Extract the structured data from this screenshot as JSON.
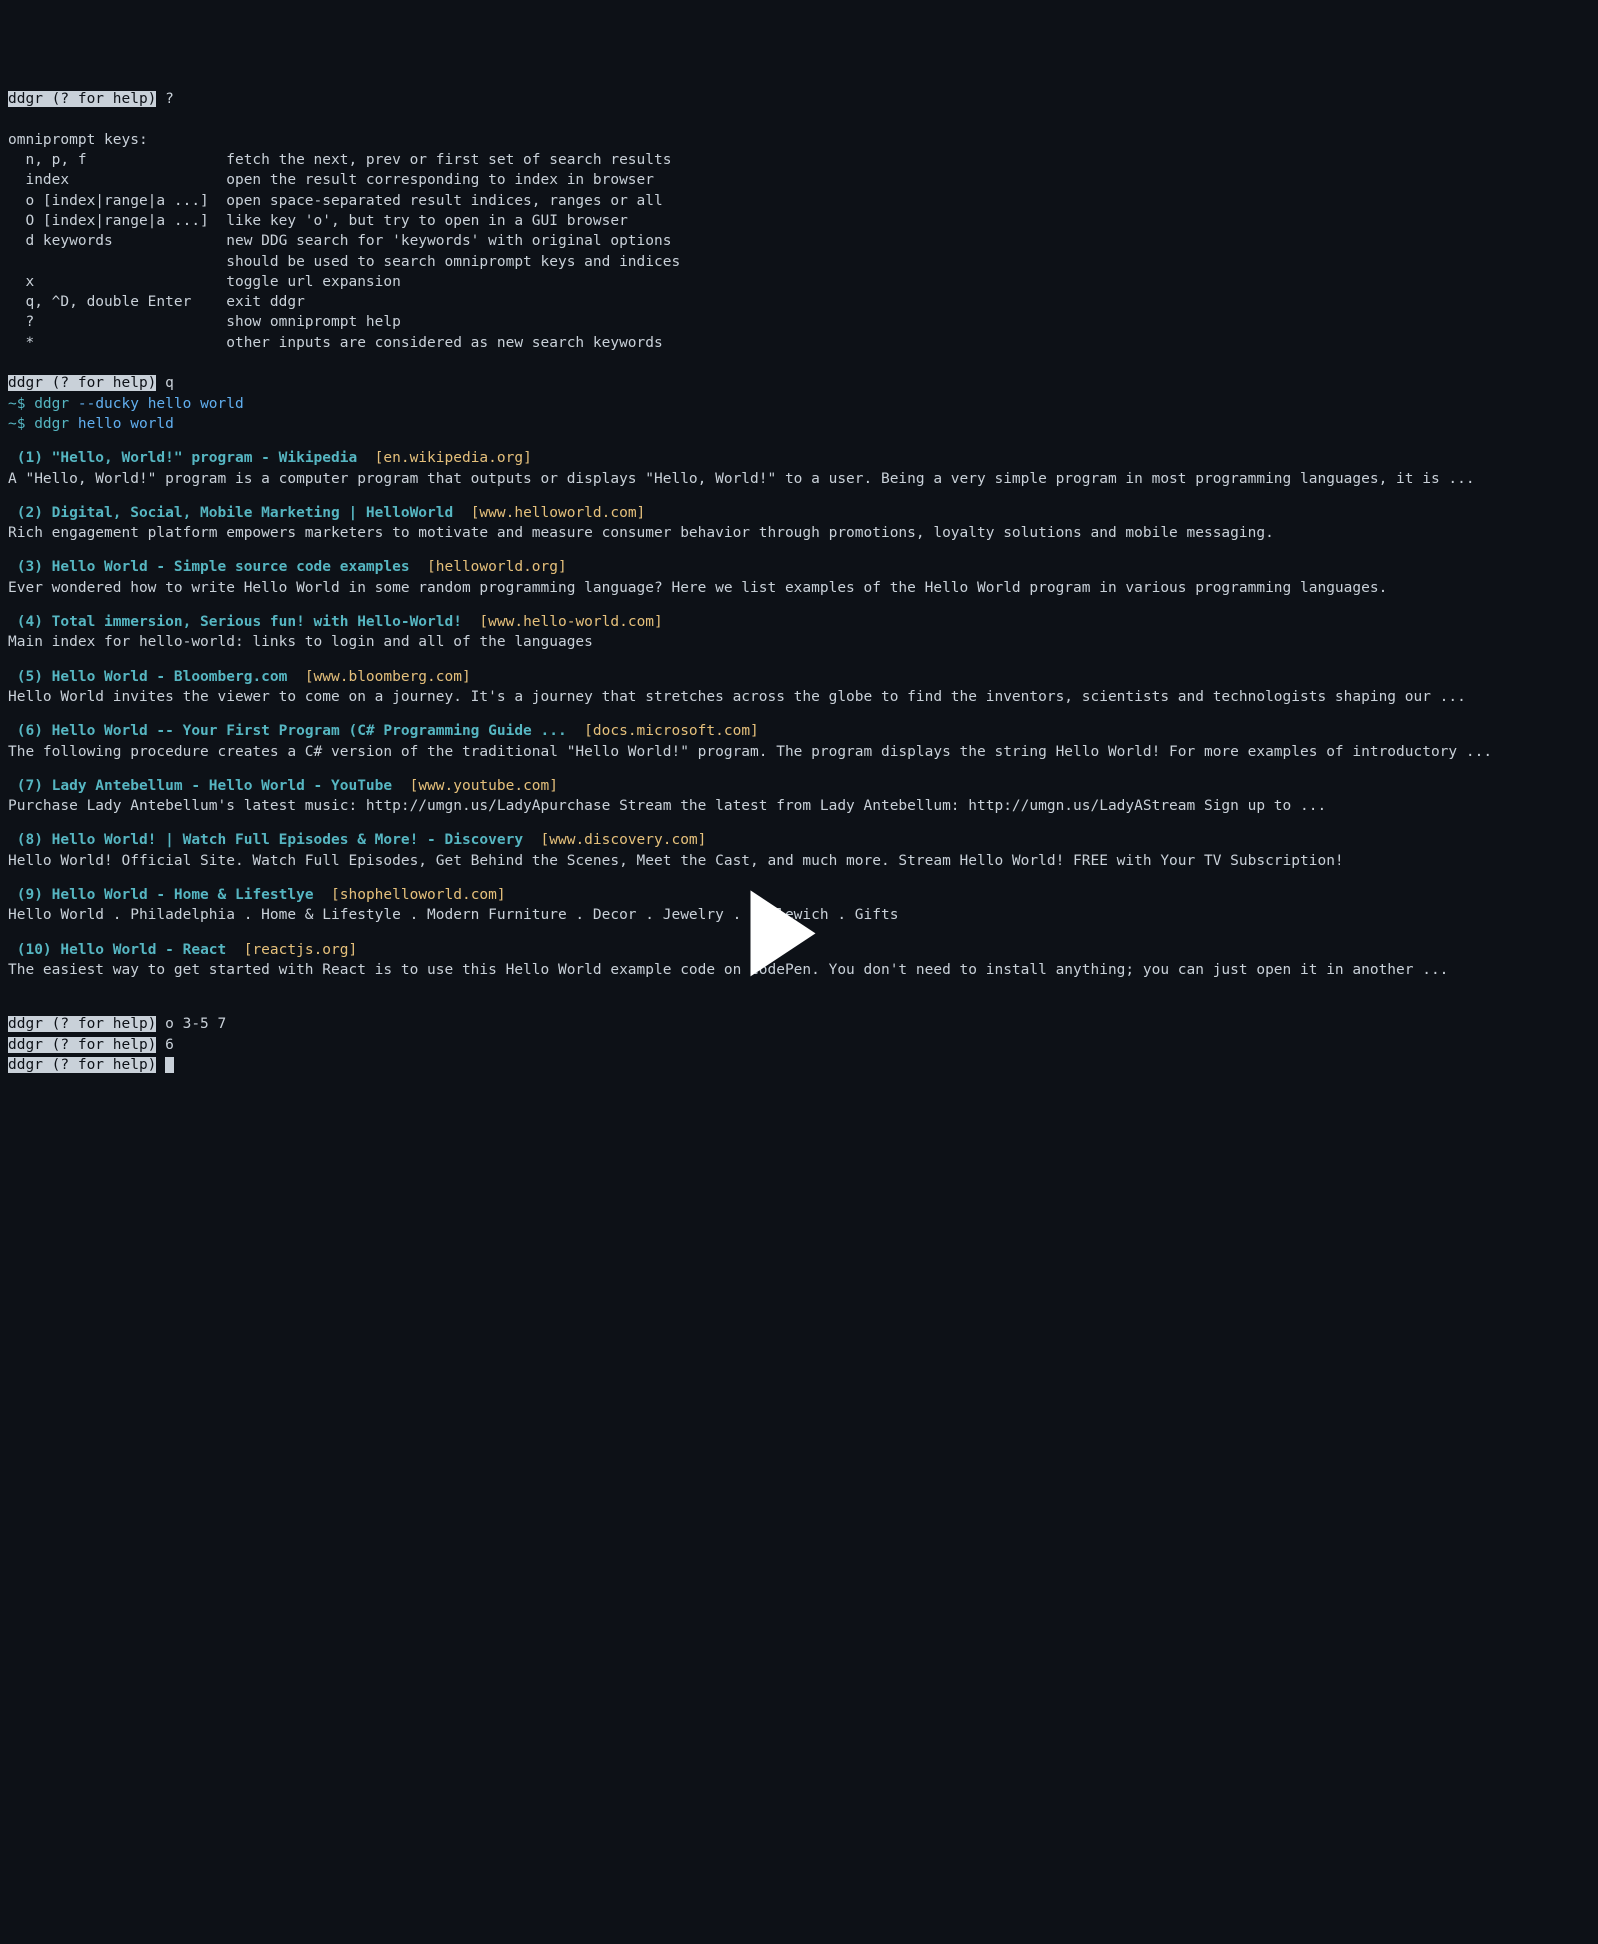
{
  "prompt_label": "ddgr (? for help)",
  "first_input": " ?",
  "help": {
    "header": "omniprompt keys:",
    "lines": [
      {
        "key": "n, p, f",
        "desc": "fetch the next, prev or first set of search results"
      },
      {
        "key": "index",
        "desc": "open the result corresponding to index in browser"
      },
      {
        "key": "o [index|range|a ...]",
        "desc": "open space-separated result indices, ranges or all"
      },
      {
        "key": "O [index|range|a ...]",
        "desc": "like key 'o', but try to open in a GUI browser"
      },
      {
        "key": "d keywords",
        "desc": "new DDG search for 'keywords' with original options"
      },
      {
        "key": "",
        "desc": "should be used to search omniprompt keys and indices"
      },
      {
        "key": "x",
        "desc": "toggle url expansion"
      },
      {
        "key": "q, ^D, double Enter",
        "desc": "exit ddgr"
      },
      {
        "key": "?",
        "desc": "show omniprompt help"
      },
      {
        "key": "*",
        "desc": "other inputs are considered as new search keywords"
      }
    ]
  },
  "second_input": " q",
  "shell": {
    "prompt": "~$",
    "cmd1_bin": "ddgr",
    "cmd1_args": "--ducky hello world",
    "cmd2_bin": "ddgr",
    "cmd2_args": "hello world"
  },
  "results": [
    {
      "n": "(1)",
      "title": "\"Hello, World!\" program - Wikipedia",
      "domain": "[en.wikipedia.org]",
      "snippet": "A \"Hello, World!\" program is a computer program that outputs or displays \"Hello, World!\" to a user. Being a very simple program in most programming languages, it is ..."
    },
    {
      "n": "(2)",
      "title": "Digital, Social, Mobile Marketing | HelloWorld",
      "domain": "[www.helloworld.com]",
      "snippet": "Rich engagement platform empowers marketers to motivate and measure consumer behavior through promotions, loyalty solutions and mobile messaging."
    },
    {
      "n": "(3)",
      "title": "Hello World - Simple source code examples",
      "domain": "[helloworld.org]",
      "snippet": "Ever wondered how to write Hello World in some random programming language? Here we list examples of the Hello World program in various programming languages."
    },
    {
      "n": "(4)",
      "title": "Total immersion, Serious fun! with Hello-World!",
      "domain": "[www.hello-world.com]",
      "snippet": "Main index for hello-world: links to login and all of the languages"
    },
    {
      "n": "(5)",
      "title": "Hello World - Bloomberg.com",
      "domain": "[www.bloomberg.com]",
      "snippet": "Hello World invites the viewer to come on a journey. It's a journey that stretches across the globe to find the inventors, scientists and technologists shaping our ..."
    },
    {
      "n": "(6)",
      "title": "Hello World -- Your First Program (C# Programming Guide ...",
      "domain": "[docs.microsoft.com]",
      "snippet": "The following procedure creates a C# version of the traditional \"Hello World!\" program. The program displays the string Hello World! For more examples of introductory ..."
    },
    {
      "n": "(7)",
      "title": "Lady Antebellum - Hello World - YouTube",
      "domain": "[www.youtube.com]",
      "snippet": "Purchase Lady Antebellum's latest music: http://umgn.us/LadyApurchase Stream the latest from Lady Antebellum: http://umgn.us/LadyAStream Sign up to ..."
    },
    {
      "n": "(8)",
      "title": "Hello World! | Watch Full Episodes & More! - Discovery",
      "domain": "[www.discovery.com]",
      "snippet": "Hello World! Official Site. Watch Full Episodes, Get Behind the Scenes, Meet the Cast, and much more. Stream Hello World! FREE with Your TV Subscription!"
    },
    {
      "n": "(9)",
      "title": "Hello World - Home & Lifestlye",
      "domain": "[shophelloworld.com]",
      "snippet": "Hello World . Philadelphia . Home & Lifestyle . Modern Furniture . Decor . Jewelry . Chilewich . Gifts"
    },
    {
      "n": "(10)",
      "title": "Hello World - React",
      "domain": "[reactjs.org]",
      "snippet": "The easiest way to get started with React is to use this Hello World example code on CodePen. You don't need to install anything; you can just open it in another ..."
    }
  ],
  "footer_inputs": [
    " o 3-5 7",
    " 6",
    " "
  ]
}
